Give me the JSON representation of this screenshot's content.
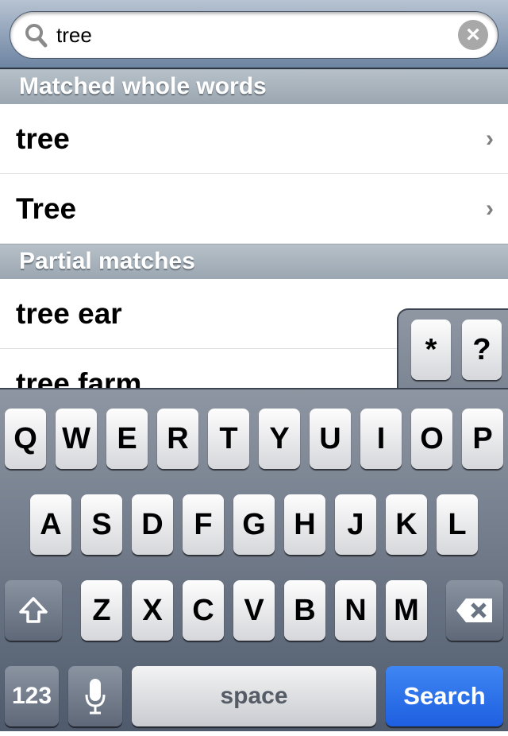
{
  "search": {
    "value": "tree",
    "clear_icon": "clear-circle-icon",
    "search_icon": "magnifier-icon"
  },
  "sections": [
    {
      "title": "Matched whole words",
      "items": [
        "tree",
        "Tree"
      ]
    },
    {
      "title": "Partial matches",
      "items": [
        "tree ear",
        "tree farm"
      ]
    }
  ],
  "chevron": "›",
  "popup_keys": [
    "*",
    "?"
  ],
  "keyboard": {
    "row1": [
      "Q",
      "W",
      "E",
      "R",
      "T",
      "Y",
      "U",
      "I",
      "O",
      "P"
    ],
    "row2": [
      "A",
      "S",
      "D",
      "F",
      "G",
      "H",
      "J",
      "K",
      "L"
    ],
    "row3": [
      "Z",
      "X",
      "C",
      "V",
      "B",
      "N",
      "M"
    ],
    "numbers_label": "123",
    "space_label": "space",
    "search_label": "Search",
    "search_color": "#2a6ff0"
  }
}
